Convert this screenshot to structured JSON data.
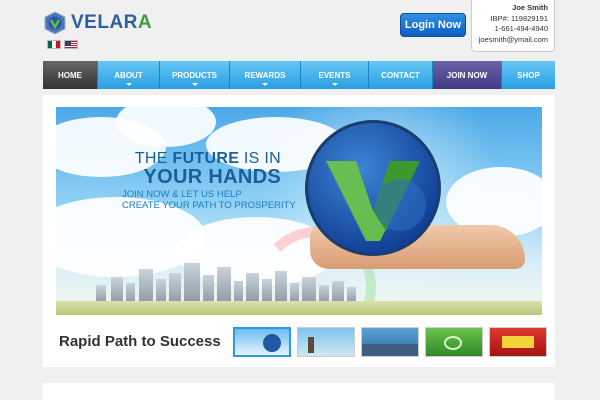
{
  "brand": {
    "name_prefix": "VELAR",
    "name_suffix": "A",
    "colors": {
      "primary": "#2f5e9e",
      "accent": "#3d9c3b"
    }
  },
  "header": {
    "flags": [
      "mexico-flag-icon",
      "usa-flag-icon"
    ],
    "login_label": "Login Now",
    "user": {
      "name": "Joe Smith",
      "ibp": "IBP#: 119829191",
      "phone": "1-661-494-4940",
      "email": "joesmith@ymail.com"
    }
  },
  "nav": {
    "items": [
      {
        "label": "HOME",
        "dropdown": false
      },
      {
        "label": "ABOUT",
        "dropdown": true
      },
      {
        "label": "PRODUCTS",
        "dropdown": true
      },
      {
        "label": "REWARDS",
        "dropdown": true
      },
      {
        "label": "EVENTS",
        "dropdown": true
      },
      {
        "label": "CONTACT",
        "dropdown": false
      },
      {
        "label": "JOIN NOW",
        "dropdown": false
      },
      {
        "label": "SHOP",
        "dropdown": false
      }
    ],
    "colors": {
      "bar": "#2a9fe3",
      "home": "#333333",
      "join": "#3e3a86"
    }
  },
  "hero": {
    "line1_pre": "THE ",
    "line1_bold": "FUTURE",
    "line1_post": " IS IN",
    "line2": "YOUR HANDS",
    "sub1": "JOIN NOW & LET US HELP",
    "sub2": "CREATE YOUR PATH TO PROSPERITY"
  },
  "rapid": {
    "title": "Rapid Path to Success",
    "thumbnails": [
      {
        "name": "slide-thumb-future",
        "active": true
      },
      {
        "name": "slide-thumb-dreams",
        "active": false
      },
      {
        "name": "slide-thumb-city",
        "active": false
      },
      {
        "name": "slide-thumb-green",
        "active": false
      },
      {
        "name": "slide-thumb-prize",
        "active": false
      }
    ]
  }
}
